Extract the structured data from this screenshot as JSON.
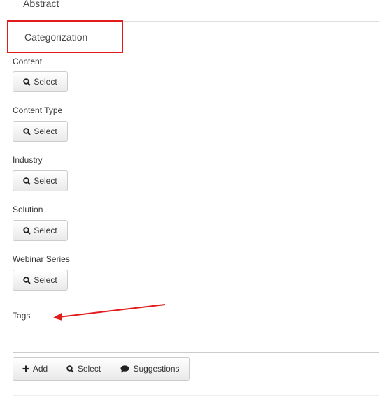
{
  "tabs": {
    "abstract": "Abstract",
    "categorization": "Categorization"
  },
  "fields": [
    {
      "label": "Content",
      "button": "Select"
    },
    {
      "label": "Content Type",
      "button": "Select"
    },
    {
      "label": "Industry",
      "button": "Select"
    },
    {
      "label": "Solution",
      "button": "Select"
    },
    {
      "label": "Webinar Series",
      "button": "Select"
    }
  ],
  "tags": {
    "label": "Tags",
    "value": "",
    "add_label": "Add",
    "select_label": "Select",
    "suggestions_label": "Suggestions"
  },
  "annotation_color": "#e21b1b"
}
